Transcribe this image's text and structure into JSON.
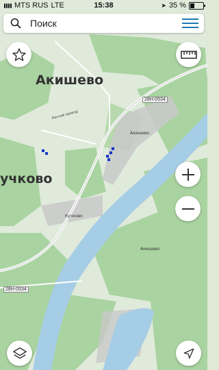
{
  "status_bar": {
    "carrier": "MTS RUS",
    "network": "LTE",
    "time": "15:38",
    "battery": "35 %",
    "battery_level": 0.35
  },
  "search": {
    "placeholder": "Поиск"
  },
  "map": {
    "labels": {
      "village_main": "Акишево",
      "village_left": "учково",
      "small_village": "Акишево",
      "small_village_2": "Акишево",
      "small_village_3": "Кучково",
      "road_small": "Лесной проезд"
    },
    "road_tags": {
      "upper": "28Н-0534",
      "lower": "28Н-0534"
    }
  },
  "controls": {
    "favorite_icon": "star-icon",
    "ruler_icon": "ruler-icon",
    "zoom_in_icon": "plus-icon",
    "zoom_out_icon": "minus-icon",
    "layers_icon": "layers-icon",
    "locate_icon": "navigation-arrow-icon"
  },
  "colors": {
    "forest": "#a9d3a0",
    "field": "#dce9d5",
    "water": "#a6cde6",
    "road": "#ffffff",
    "accent": "#1f78b4"
  }
}
